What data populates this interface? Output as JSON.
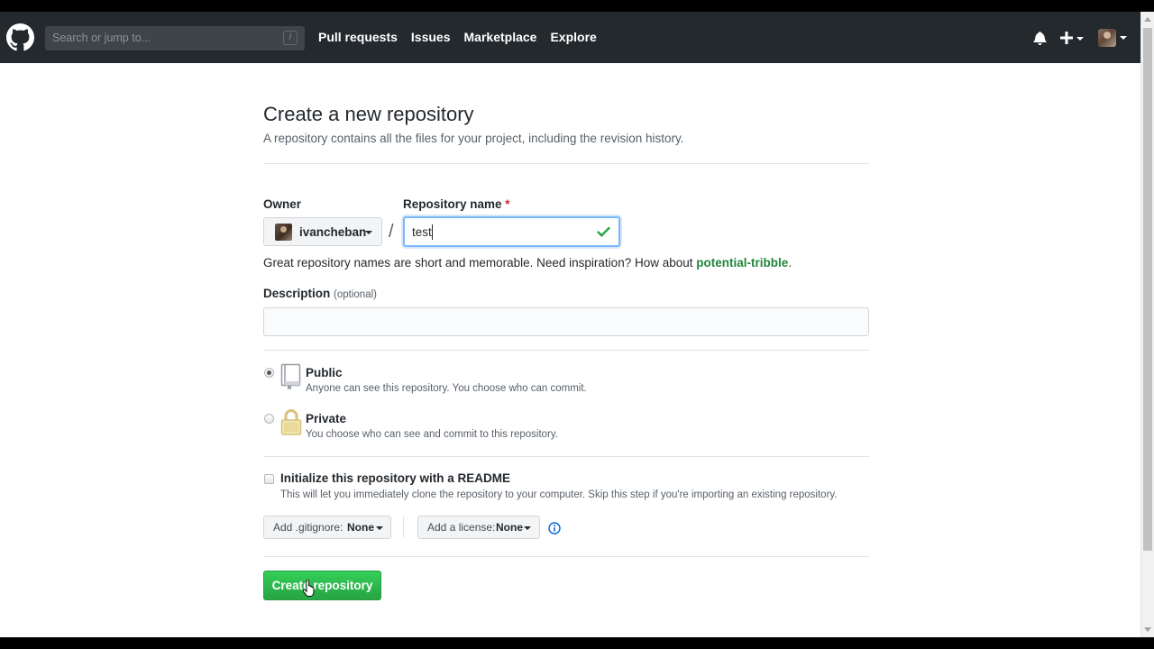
{
  "header": {
    "search_placeholder": "Search or jump to...",
    "search_shortcut": "/",
    "nav": [
      {
        "label": "Pull requests"
      },
      {
        "label": "Issues"
      },
      {
        "label": "Marketplace"
      },
      {
        "label": "Explore"
      }
    ]
  },
  "page": {
    "title": "Create a new repository",
    "subtitle": "A repository contains all the files for your project, including the revision history."
  },
  "form": {
    "owner_label": "Owner",
    "owner_value": "ivancheban",
    "separator": "/",
    "repo_label": "Repository name",
    "required_mark": "*",
    "repo_value": "test",
    "hint_prefix": "Great repository names are short and memorable. Need inspiration? How about ",
    "hint_suggestion": "potential-tribble",
    "hint_suffix": ".",
    "description_label": "Description",
    "description_optional": "(optional)",
    "description_value": "",
    "visibility": [
      {
        "title": "Public",
        "note": "Anyone can see this repository. You choose who can commit.",
        "selected": true
      },
      {
        "title": "Private",
        "note": "You choose who can see and commit to this repository.",
        "selected": false
      }
    ],
    "init_title": "Initialize this repository with a README",
    "init_note": "This will let you immediately clone the repository to your computer. Skip this step if you're importing an existing repository.",
    "init_checked": false,
    "gitignore_label": "Add .gitignore:",
    "gitignore_value": "None",
    "license_label": "Add a license:",
    "license_value": "None",
    "submit_label": "Create repository"
  },
  "colors": {
    "header_bg": "#24292e",
    "primary_button": "#28a745",
    "suggestion_link": "#22863a",
    "input_focus": "#79b8ff",
    "valid_check": "#28a745",
    "required": "#cb2431"
  }
}
